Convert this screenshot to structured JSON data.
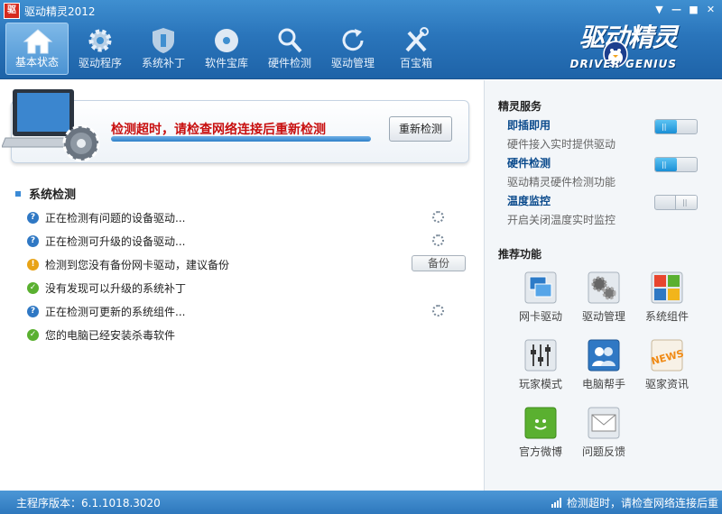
{
  "window": {
    "logo_text": "驱",
    "title": "驱动精灵2012",
    "controls": [
      "▼",
      "—",
      "■",
      "✕"
    ]
  },
  "toolbar": {
    "items": [
      {
        "label": "基本状态",
        "icon": "home-icon",
        "active": true
      },
      {
        "label": "驱动程序",
        "icon": "gear-icon",
        "active": false
      },
      {
        "label": "系统补丁",
        "icon": "shield-icon",
        "active": false
      },
      {
        "label": "软件宝库",
        "icon": "disc-icon",
        "active": false
      },
      {
        "label": "硬件检测",
        "icon": "magnifier-icon",
        "active": false
      },
      {
        "label": "驱动管理",
        "icon": "refresh-icon",
        "active": false
      },
      {
        "label": "百宝箱",
        "icon": "tools-icon",
        "active": false
      }
    ]
  },
  "brand": {
    "logo_text": "驱动精灵",
    "subtitle": "DRIVER GENIUS"
  },
  "status_panel": {
    "message": "检测超时，请检查网络连接后重新检测",
    "progress": 1.0,
    "redetect_label": "重新检测"
  },
  "system_check": {
    "title": "系统检测",
    "items": [
      {
        "icon": "question-icon",
        "text": "正在检测有问题的设备驱动...",
        "state": "spinner"
      },
      {
        "icon": "question-icon",
        "text": "正在检测可升级的设备驱动...",
        "state": "spinner"
      },
      {
        "icon": "warning-icon",
        "text": "检测到您没有备份网卡驱动，建议备份",
        "state": "button",
        "button_label": "备份"
      },
      {
        "icon": "ok-icon",
        "text": "没有发现可以升级的系统补丁",
        "state": "none"
      },
      {
        "icon": "question-icon",
        "text": "正在检测可更新的系统组件...",
        "state": "spinner"
      },
      {
        "icon": "ok-icon",
        "text": "您的电脑已经安装杀毒软件",
        "state": "none"
      }
    ]
  },
  "services": {
    "title": "精灵服务",
    "items": [
      {
        "name": "即插即用",
        "desc": "硬件接入实时提供驱动",
        "on": true
      },
      {
        "name": "硬件检测",
        "desc": "驱动精灵硬件检测功能",
        "on": true
      },
      {
        "name": "温度监控",
        "desc": "开启关闭温度实时监控",
        "on": false
      }
    ]
  },
  "recommended": {
    "title": "推荐功能",
    "items": [
      {
        "label": "网卡驱动",
        "icon": "network-card-icon"
      },
      {
        "label": "驱动管理",
        "icon": "gears-icon"
      },
      {
        "label": "系统组件",
        "icon": "components-icon"
      },
      {
        "label": "玩家模式",
        "icon": "equalizer-icon"
      },
      {
        "label": "电脑帮手",
        "icon": "helper-icon"
      },
      {
        "label": "驱家资讯",
        "icon": "news-icon"
      },
      {
        "label": "官方微博",
        "icon": "weibo-icon"
      },
      {
        "label": "问题反馈",
        "icon": "feedback-icon"
      }
    ]
  },
  "statusbar": {
    "version_label": "主程序版本：",
    "version_value": "6.1.1018.3020",
    "status_text": "检测超时，请检查网络连接后重"
  },
  "colors": {
    "accent": "#2a75bb",
    "error_text": "#c81010",
    "service_name": "#0a4a8c"
  }
}
